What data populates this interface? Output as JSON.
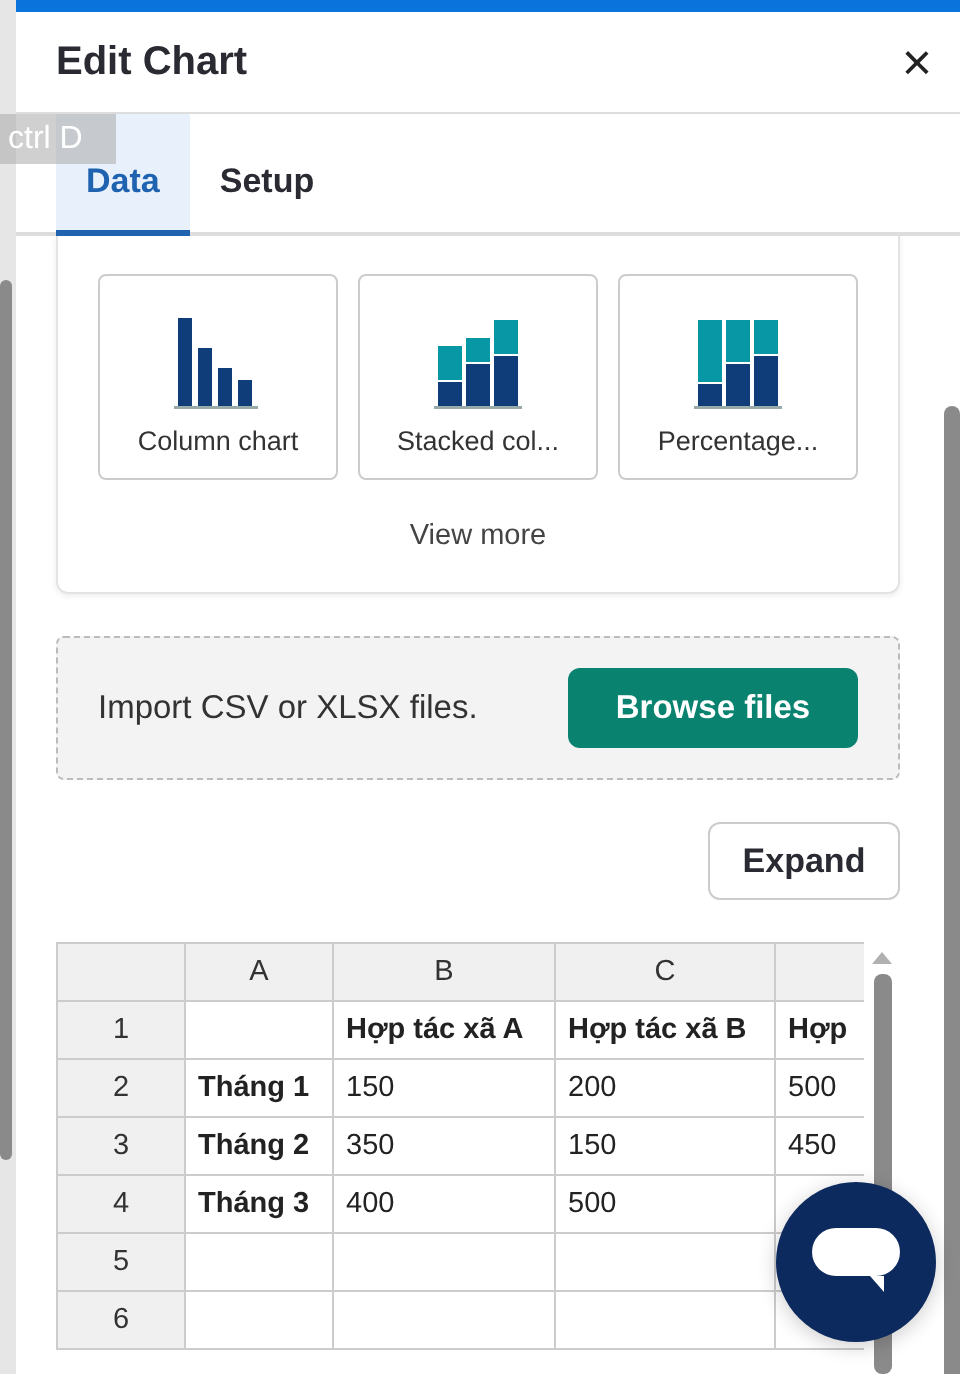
{
  "dialog": {
    "title": "Edit Chart",
    "close": "×"
  },
  "tooltip": {
    "text": "ctrl D"
  },
  "tabs": [
    {
      "label": "Data",
      "selected": true
    },
    {
      "label": "Setup",
      "selected": false
    }
  ],
  "chart_types": {
    "items": [
      {
        "label": "Column chart",
        "kind": "column"
      },
      {
        "label": "Stacked col...",
        "kind": "stacked"
      },
      {
        "label": "Percentage...",
        "kind": "percentage"
      }
    ],
    "more": "View more"
  },
  "import": {
    "text": "Import CSV or XLSX files.",
    "button": "Browse files"
  },
  "expand_button": "Expand",
  "sheet": {
    "columns": [
      "A",
      "B",
      "C"
    ],
    "rows": [
      {
        "number": "1",
        "cells": [
          null,
          "Hợp tác xã A",
          "Hợp tác xã B",
          "Hợp"
        ]
      },
      {
        "number": "2",
        "cells": [
          "Tháng 1",
          "150",
          "200",
          "500"
        ]
      },
      {
        "number": "3",
        "cells": [
          "Tháng 2",
          "350",
          "150",
          "450"
        ]
      },
      {
        "number": "4",
        "cells": [
          "Tháng 3",
          "400",
          "500",
          null
        ]
      },
      {
        "number": "5",
        "cells": [
          null,
          null,
          null,
          null
        ]
      },
      {
        "number": "6",
        "cells": [
          null,
          null,
          null,
          null
        ]
      }
    ]
  }
}
